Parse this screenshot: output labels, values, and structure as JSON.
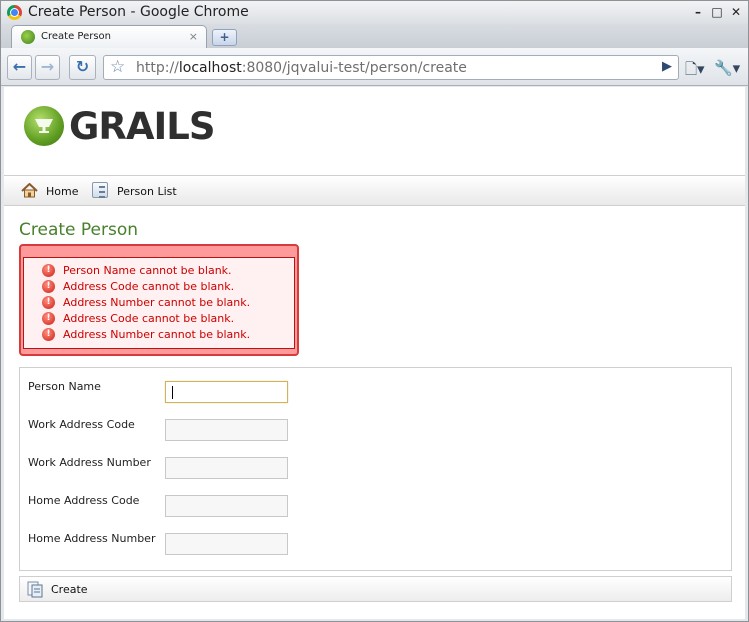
{
  "window": {
    "title": "Create Person - Google Chrome"
  },
  "tab": {
    "label": "Create Person",
    "close": "×",
    "new_tab": "+"
  },
  "toolbar": {
    "back": "←",
    "forward": "→",
    "reload": "↻",
    "url_scheme": "http://",
    "url_host": "localhost",
    "url_rest": ":8080/jqvalui-test/person/create"
  },
  "logo": {
    "text": "GRAILS"
  },
  "nav": {
    "home": "Home",
    "person_list": "Person List"
  },
  "page_title": "Create Person",
  "errors": [
    "Person Name cannot be blank.",
    "Address Code cannot be blank.",
    "Address Number cannot be blank.",
    "Address Code cannot be blank.",
    "Address Number cannot be blank."
  ],
  "form": {
    "person_name": {
      "label": "Person Name",
      "value": ""
    },
    "work_address_code": {
      "label": "Work Address Code",
      "value": ""
    },
    "work_address_number": {
      "label": "Work Address Number",
      "value": ""
    },
    "home_address_code": {
      "label": "Home Address Code",
      "value": ""
    },
    "home_address_number": {
      "label": "Home Address Number",
      "value": ""
    }
  },
  "buttons": {
    "create": "Create"
  },
  "colors": {
    "title_green": "#48802c",
    "error_red": "#cc0000",
    "error_bg": "#fff1f1"
  }
}
